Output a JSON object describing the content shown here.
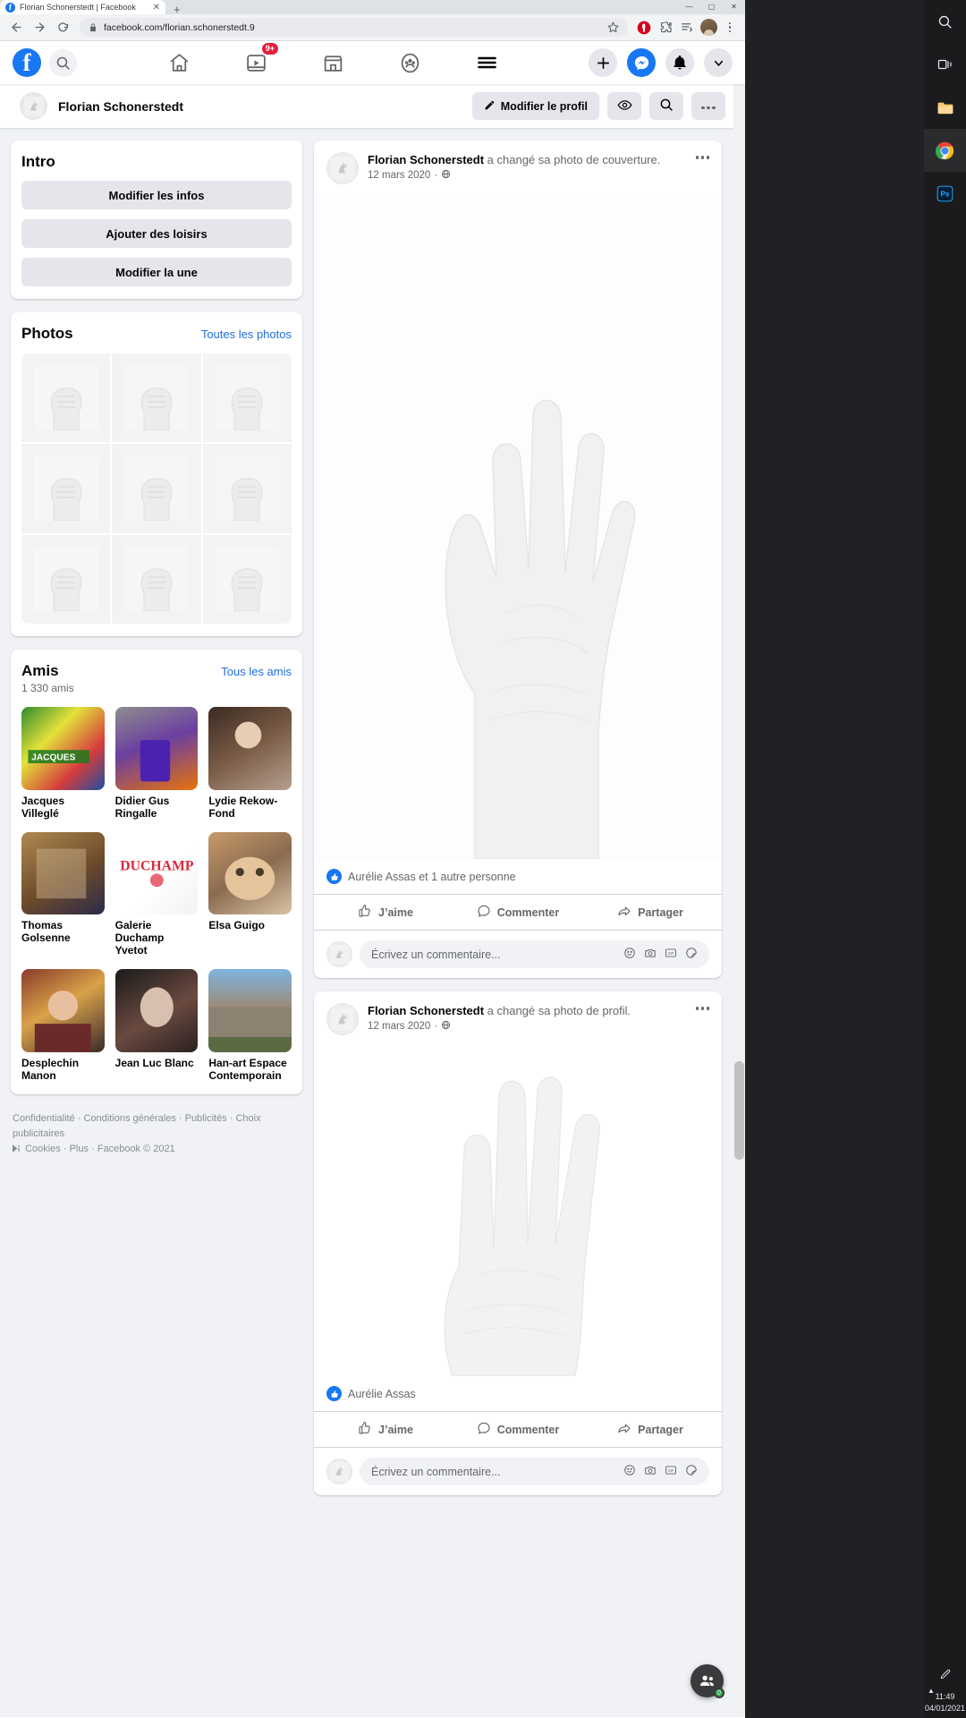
{
  "browser": {
    "tab_title": "Florian Schonerstedt | Facebook",
    "tab_favicon": "f",
    "close_tab_icon": "✕",
    "new_tab_icon": "+",
    "window_minimize": "—",
    "window_maximize": "▢",
    "window_close": "✕",
    "back_icon": "back-arrow-icon",
    "forward_icon": "forward-arrow-icon",
    "reload_icon": "reload-icon",
    "lock_icon": "lock-icon",
    "url": "facebook.com/florian.schonerstedt.9",
    "bookmark_icon": "star-icon",
    "extensions": [
      "opera-vpn-icon",
      "puzzle-extension-icon",
      "reading-list-icon"
    ],
    "profile_avatar": "chrome-profile-avatar",
    "menu_icon": "three-dot-menu-icon"
  },
  "fbnav": {
    "logo": "f",
    "search_icon": "search-icon",
    "tabs": [
      {
        "name": "home-tab",
        "icon": "home-icon",
        "badge": ""
      },
      {
        "name": "watch-tab",
        "icon": "video-icon",
        "badge": "9+"
      },
      {
        "name": "marketplace-tab",
        "icon": "shop-icon",
        "badge": ""
      },
      {
        "name": "groups-tab",
        "icon": "groups-icon",
        "badge": ""
      },
      {
        "name": "menu-tab",
        "icon": "hamburger-icon",
        "badge": ""
      }
    ],
    "right_buttons": [
      {
        "name": "create-button",
        "icon": "plus-icon"
      },
      {
        "name": "messenger-button",
        "icon": "messenger-icon"
      },
      {
        "name": "notifications-button",
        "icon": "bell-icon"
      },
      {
        "name": "account-menu-button",
        "icon": "chevron-down-icon"
      }
    ]
  },
  "profilebar": {
    "name": "Florian Schonerstedt",
    "edit_profile_label": "Modifier le profil",
    "edit_profile_icon": "pencil-icon",
    "view_as_icon": "eye-icon",
    "search_icon": "search-icon",
    "more_icon": "ellipsis-icon"
  },
  "intro": {
    "title": "Intro",
    "buttons": [
      "Modifier les infos",
      "Ajouter des loisirs",
      "Modifier la une"
    ]
  },
  "photos": {
    "title": "Photos",
    "link": "Toutes les photos",
    "count": 9,
    "thumb_icon": "fist-hand-photo"
  },
  "friends": {
    "title": "Amis",
    "link": "Tous les amis",
    "count_label": "1 330 amis",
    "items": [
      {
        "name": "Jacques Villeglé",
        "thumb": "collage-poster-thumb"
      },
      {
        "name": "Didier Gus Ringalle",
        "thumb": "man-orange-jacket-thumb"
      },
      {
        "name": "Lydie Rekow-Fond",
        "thumb": "woman-library-thumb"
      },
      {
        "name": "Thomas Golsenne",
        "thumb": "painting-thumb"
      },
      {
        "name": "Galerie Duchamp Yvetot",
        "thumb": "logo-duchamp-thumb"
      },
      {
        "name": "Elsa Guigo",
        "thumb": "cat-thumb"
      },
      {
        "name": "Desplechin Manon",
        "thumb": "woman-flowers-thumb"
      },
      {
        "name": "Jean Luc Blanc",
        "thumb": "portrait-dark-thumb"
      },
      {
        "name": "Han-art Espace Contemporain",
        "thumb": "stone-building-thumb"
      }
    ]
  },
  "footer": {
    "line1": "Confidentialité · Conditions générales · Publicités · Choix publicitaires",
    "adchoices_icon": "adchoices-icon",
    "line2": "Cookies · Plus · Facebook © 2021"
  },
  "posts": [
    {
      "author": "Florian Schonerstedt",
      "action": "a changé sa photo de couverture.",
      "date": "12 mars 2020",
      "privacy_icon": "globe-icon",
      "more_icon": "ellipsis-icon",
      "image": "open-hand-palm-photo",
      "reactions": "Aurélie Assas et 1 autre personne",
      "reaction_icon": "like-thumb-icon",
      "actions": [
        {
          "label": "J’aime",
          "icon": "thumbs-up-icon"
        },
        {
          "label": "Commenter",
          "icon": "comment-bubble-icon"
        },
        {
          "label": "Partager",
          "icon": "share-arrow-icon"
        }
      ],
      "comment_placeholder": "Écrivez un commentaire...",
      "comment_icons": [
        "emoji-icon",
        "camera-icon",
        "gif-icon",
        "sticker-icon"
      ]
    },
    {
      "author": "Florian Schonerstedt",
      "action": "a changé sa photo de profil.",
      "date": "12 mars 2020",
      "privacy_icon": "globe-icon",
      "more_icon": "ellipsis-icon",
      "image": "hand-fingers-photo",
      "reactions": "Aurélie Assas",
      "reaction_icon": "like-thumb-icon",
      "actions": [
        {
          "label": "J’aime",
          "icon": "thumbs-up-icon"
        },
        {
          "label": "Commenter",
          "icon": "comment-bubble-icon"
        },
        {
          "label": "Partager",
          "icon": "share-arrow-icon"
        }
      ],
      "comment_placeholder": "Écrivez un commentaire...",
      "comment_icons": [
        "emoji-icon",
        "camera-icon",
        "gif-icon",
        "sticker-icon"
      ]
    }
  ],
  "taskbar": {
    "items": [
      {
        "name": "search-taskbar-icon",
        "icon": "search-icon"
      },
      {
        "name": "task-view-icon",
        "icon": "taskview-icon"
      },
      {
        "name": "file-explorer-icon",
        "icon": "folder-icon"
      },
      {
        "name": "chrome-taskbar-icon",
        "icon": "chrome-icon"
      },
      {
        "name": "photoshop-taskbar-icon",
        "icon": "ps-icon"
      }
    ],
    "clock_time": "11:49",
    "clock_date": "04/01/2021",
    "pen_icon": "pen-icon",
    "tray_caret": "caret-up-icon"
  },
  "chat": {
    "icon": "messenger-contacts-icon",
    "badge": "0"
  },
  "colors": {
    "fb_blue": "#1877f2",
    "page_bg": "#f0f2f5",
    "card_bg": "#ffffff",
    "link_blue": "#216fdb",
    "badge_red": "#e41e3f"
  }
}
